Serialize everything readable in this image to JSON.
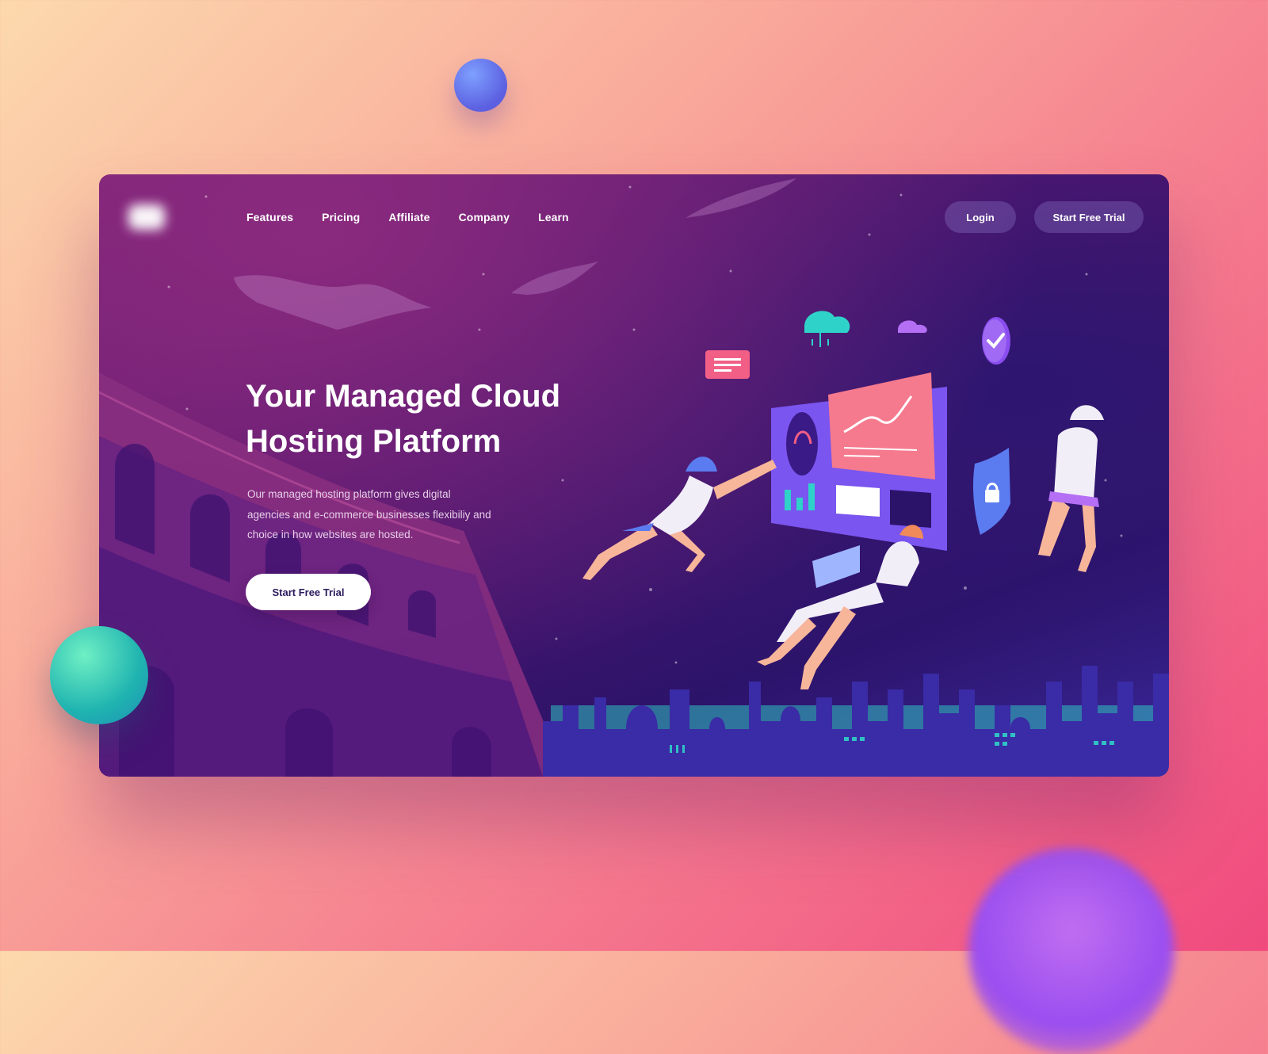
{
  "nav": {
    "items": [
      {
        "label": "Features"
      },
      {
        "label": "Pricing"
      },
      {
        "label": "Affiliate"
      },
      {
        "label": "Company"
      },
      {
        "label": "Learn"
      }
    ],
    "login_label": "Login",
    "trial_label": "Start Free Trial"
  },
  "hero": {
    "title": "Your Managed Cloud Hosting Platform",
    "description": "Our managed hosting platform gives digital agencies and e-commerce businesses flexibiliy and choice in how websites are hosted.",
    "cta_label": "Start Free Trial"
  },
  "colors": {
    "accent_pink": "#f25f86",
    "accent_purple": "#8a4df0",
    "accent_teal": "#2fd2c8",
    "card_dark": "#2c136a"
  },
  "icons": [
    "logo",
    "cloud-icon",
    "small-cloud-icon",
    "check-badge-icon",
    "message-card-icon",
    "gauge-icon",
    "shield-lock-icon",
    "laptop-icon"
  ]
}
